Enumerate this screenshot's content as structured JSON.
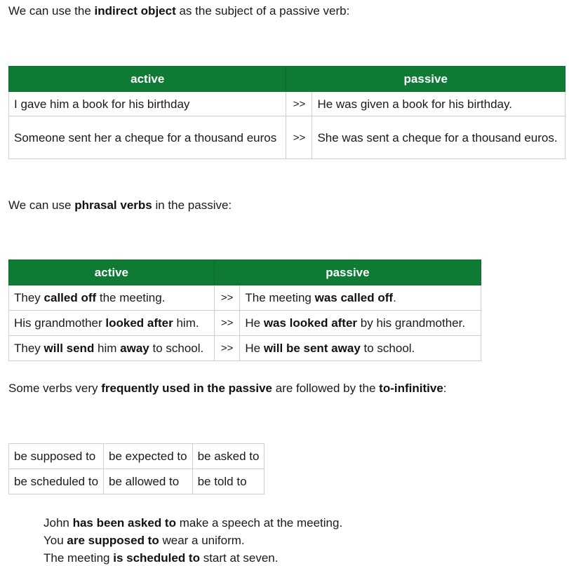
{
  "intro1": {
    "pre": "We can use the ",
    "bold": "indirect object",
    "post": " as the subject of a passive verb:"
  },
  "table1": {
    "headers": [
      "active",
      "passive"
    ],
    "rows": [
      {
        "active": "I gave him a book for his birthday",
        "arrow": ">>",
        "passive": "He was given a book for his birthday."
      },
      {
        "active": "Someone sent her a cheque for a thousand euros",
        "arrow": ">>",
        "passive": "She was sent a cheque for a thousand euros."
      }
    ]
  },
  "intro2": {
    "pre": "We can use ",
    "bold": "phrasal verbs",
    "post": " in the passive:"
  },
  "table2": {
    "headers": [
      "active",
      "passive"
    ],
    "rows": [
      {
        "active": [
          [
            "They ",
            false
          ],
          [
            "called off",
            true
          ],
          [
            " the meeting.",
            false
          ]
        ],
        "arrow": ">>",
        "passive": [
          [
            "The meeting ",
            false
          ],
          [
            "was called off",
            true
          ],
          [
            ".",
            false
          ]
        ]
      },
      {
        "active": [
          [
            "His grandmother ",
            false
          ],
          [
            "looked after",
            true
          ],
          [
            " him.",
            false
          ]
        ],
        "arrow": ">>",
        "passive": [
          [
            "He ",
            false
          ],
          [
            "was looked after",
            true
          ],
          [
            " by his grandmother.",
            false
          ]
        ]
      },
      {
        "active": [
          [
            "They ",
            false
          ],
          [
            "will send",
            true
          ],
          [
            " him ",
            false
          ],
          [
            "away",
            true
          ],
          [
            " to school.",
            false
          ]
        ],
        "arrow": ">>",
        "passive": [
          [
            "He ",
            false
          ],
          [
            "will be sent away",
            true
          ],
          [
            " to school.",
            false
          ]
        ]
      }
    ]
  },
  "intro3": {
    "pre": "Some verbs very ",
    "bold": "frequently used in the passive",
    "mid": " are followed by the ",
    "bold2": "to-infinitive",
    "post": ":"
  },
  "verbs_table": [
    [
      "be supposed to",
      "be expected to",
      "be asked to"
    ],
    [
      "be scheduled to",
      "be allowed to",
      "be told to"
    ]
  ],
  "examples": [
    [
      [
        "John ",
        false
      ],
      [
        "has been asked to",
        true
      ],
      [
        " make a speech at the meeting.",
        false
      ]
    ],
    [
      [
        "You ",
        false
      ],
      [
        "are supposed to",
        true
      ],
      [
        " wear a uniform.",
        false
      ]
    ],
    [
      [
        "The meeting ",
        false
      ],
      [
        "is scheduled to",
        true
      ],
      [
        " start at seven.",
        false
      ]
    ]
  ],
  "colors": {
    "header_bg": "#0e7a34",
    "header_text": "#ffffff",
    "border": "#cfcfcf"
  }
}
